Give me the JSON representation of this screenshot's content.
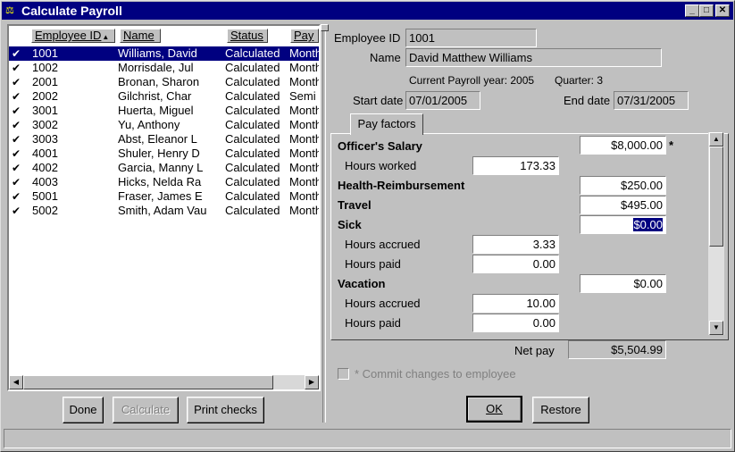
{
  "window": {
    "title": "Calculate Payroll"
  },
  "list": {
    "columns": [
      "Employee ID",
      "Name",
      "Status",
      "Pay"
    ],
    "sort_indicator": "▲",
    "rows": [
      {
        "id": "1001",
        "name": "Williams, David",
        "status": "Calculated",
        "pay": "Month",
        "selected": true
      },
      {
        "id": "1002",
        "name": "Morrisdale, Jul",
        "status": "Calculated",
        "pay": "Month"
      },
      {
        "id": "2001",
        "name": "Bronan, Sharon",
        "status": "Calculated",
        "pay": "Month"
      },
      {
        "id": "2002",
        "name": "Gilchrist, Char",
        "status": "Calculated",
        "pay": "Semi"
      },
      {
        "id": "3001",
        "name": "Huerta, Miguel",
        "status": "Calculated",
        "pay": "Month"
      },
      {
        "id": "3002",
        "name": "Yu, Anthony",
        "status": "Calculated",
        "pay": "Month"
      },
      {
        "id": "3003",
        "name": "Abst, Eleanor L",
        "status": "Calculated",
        "pay": "Month"
      },
      {
        "id": "4001",
        "name": "Shuler, Henry D",
        "status": "Calculated",
        "pay": "Month"
      },
      {
        "id": "4002",
        "name": "Garcia, Manny L",
        "status": "Calculated",
        "pay": "Month"
      },
      {
        "id": "4003",
        "name": "Hicks, Nelda Ra",
        "status": "Calculated",
        "pay": "Month"
      },
      {
        "id": "5001",
        "name": "Fraser, James E",
        "status": "Calculated",
        "pay": "Month"
      },
      {
        "id": "5002",
        "name": "Smith, Adam Vau",
        "status": "Calculated",
        "pay": "Month"
      }
    ]
  },
  "buttons": {
    "done": "Done",
    "calculate": "Calculate",
    "print_checks": "Print checks",
    "ok": "OK",
    "restore": "Restore"
  },
  "detail": {
    "employee_id_label": "Employee ID",
    "employee_id": "1001",
    "name_label": "Name",
    "name": "David Matthew Williams",
    "payroll_year_text": "Current Payroll year: 2005",
    "quarter_text": "Quarter:  3",
    "start_date_label": "Start date",
    "start_date": "07/01/2005",
    "end_date_label": "End date",
    "end_date": "07/31/2005",
    "tab_label": "Pay factors",
    "net_pay_label": "Net pay",
    "net_pay": "$5,504.99",
    "commit_label": "* Commit changes to employee"
  },
  "pay_factors": {
    "officers_salary_label": "Officer's Salary",
    "officers_salary": "$8,000.00",
    "changed_marker": "*",
    "hours_worked_label": "Hours worked",
    "hours_worked": "173.33",
    "health_label": "Health-Reimbursement",
    "health": "$250.00",
    "travel_label": "Travel",
    "travel": "$495.00",
    "sick_label": "Sick",
    "sick": "$0.00",
    "sick_hours_accrued_label": "Hours accrued",
    "sick_hours_accrued": "3.33",
    "sick_hours_paid_label": "Hours paid",
    "sick_hours_paid": "0.00",
    "vacation_label": "Vacation",
    "vacation": "$0.00",
    "vac_hours_accrued_label": "Hours accrued",
    "vac_hours_accrued": "10.00",
    "vac_hours_paid_label": "Hours paid",
    "vac_hours_paid": "0.00"
  }
}
